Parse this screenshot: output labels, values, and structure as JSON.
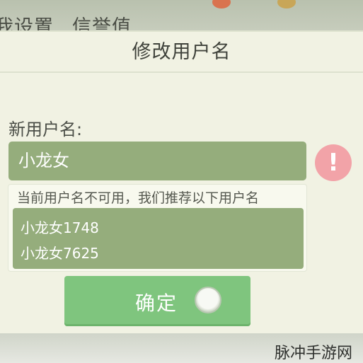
{
  "background": {
    "title_items": [
      "我设置",
      "信誉值"
    ]
  },
  "dialog": {
    "title": "修改用户名",
    "field_label": "新用户名:",
    "input_value": "小龙女",
    "suggest_hint": "当前用户名不可用，我们推荐以下用户名",
    "suggestions": [
      "小龙女1748",
      "小龙女7625"
    ],
    "confirm_label": "确定"
  },
  "watermark": "脉冲手游网",
  "colors": {
    "input_bg": "#95ad7c",
    "dialog_bg": "#f1f2e3",
    "confirm_bg": "#7fc57e",
    "error_icon": "#f2a3a8"
  },
  "icons": {
    "error": "exclamation-icon",
    "press": "touch-indicator-icon"
  }
}
